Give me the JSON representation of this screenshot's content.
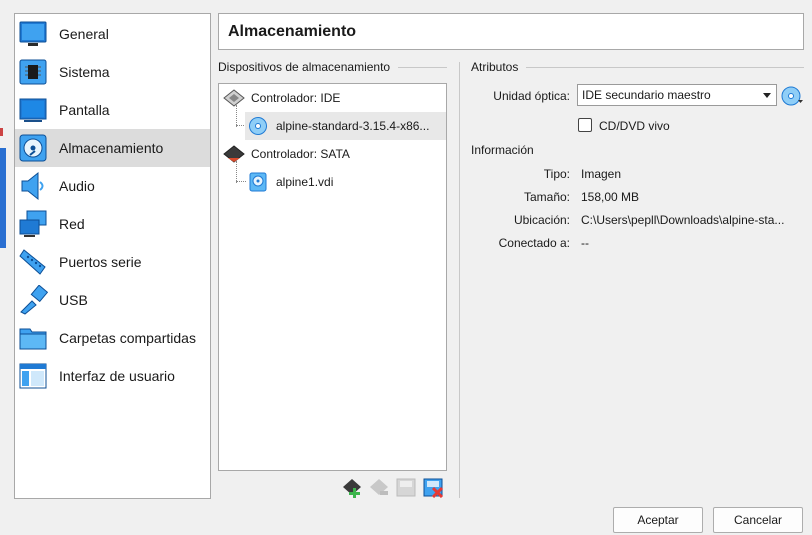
{
  "sidebar": {
    "items": [
      {
        "label": "General",
        "icon": "monitor-icon"
      },
      {
        "label": "Sistema",
        "icon": "chip-icon"
      },
      {
        "label": "Pantalla",
        "icon": "display-icon"
      },
      {
        "label": "Almacenamiento",
        "icon": "disk-icon",
        "selected": true
      },
      {
        "label": "Audio",
        "icon": "speaker-icon"
      },
      {
        "label": "Red",
        "icon": "network-icon"
      },
      {
        "label": "Puertos serie",
        "icon": "serial-port-icon"
      },
      {
        "label": "USB",
        "icon": "usb-icon"
      },
      {
        "label": "Carpetas compartidas",
        "icon": "folder-icon"
      },
      {
        "label": "Interfaz de usuario",
        "icon": "window-icon"
      }
    ]
  },
  "header": {
    "title": "Almacenamiento"
  },
  "storage": {
    "section_label": "Dispositivos de almacenamiento",
    "controllers": [
      {
        "label": "Controlador: IDE",
        "devices": [
          {
            "label": "alpine-standard-3.15.4-x86...",
            "icon": "optical-disc-icon",
            "selected": true
          }
        ]
      },
      {
        "label": "Controlador: SATA",
        "devices": [
          {
            "label": "alpine1.vdi",
            "icon": "hard-disk-icon"
          }
        ]
      }
    ]
  },
  "attributes": {
    "section_label": "Atributos",
    "optical_drive_label": "Unidad óptica:",
    "optical_drive_value": "IDE secundario maestro",
    "live_cd_label": "CD/DVD vivo",
    "live_cd_checked": false
  },
  "information": {
    "section_label": "Información",
    "rows": [
      {
        "label": "Tipo:",
        "value": "Imagen"
      },
      {
        "label": "Tamaño:",
        "value": "158,00 MB"
      },
      {
        "label": "Ubicación:",
        "value": "C:\\Users\\pepll\\Downloads\\alpine-sta..."
      },
      {
        "label": "Conectado a:",
        "value": "--"
      }
    ]
  },
  "buttons": {
    "accept": "Aceptar",
    "cancel": "Cancelar"
  },
  "colors": {
    "accent": "#2a8fe0",
    "selection": "#dcdcdc"
  }
}
